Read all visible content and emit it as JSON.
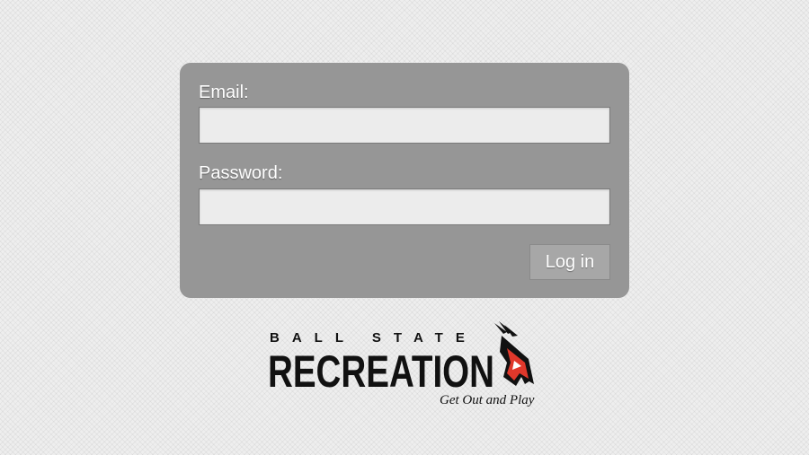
{
  "login_form": {
    "email_label": "Email:",
    "email_value": "",
    "password_label": "Password:",
    "password_value": "",
    "login_button_label": "Log in"
  },
  "logo": {
    "top_text": "BALL STATE",
    "main_text": "RECREATION",
    "tagline": "Get Out and Play",
    "icon": "cardinal-bird-icon"
  },
  "colors": {
    "panel": "#969696",
    "input_background": "#ececec",
    "button": "#a7a7a7",
    "label_text": "#ffffff",
    "brand_red": "#e0382b"
  }
}
